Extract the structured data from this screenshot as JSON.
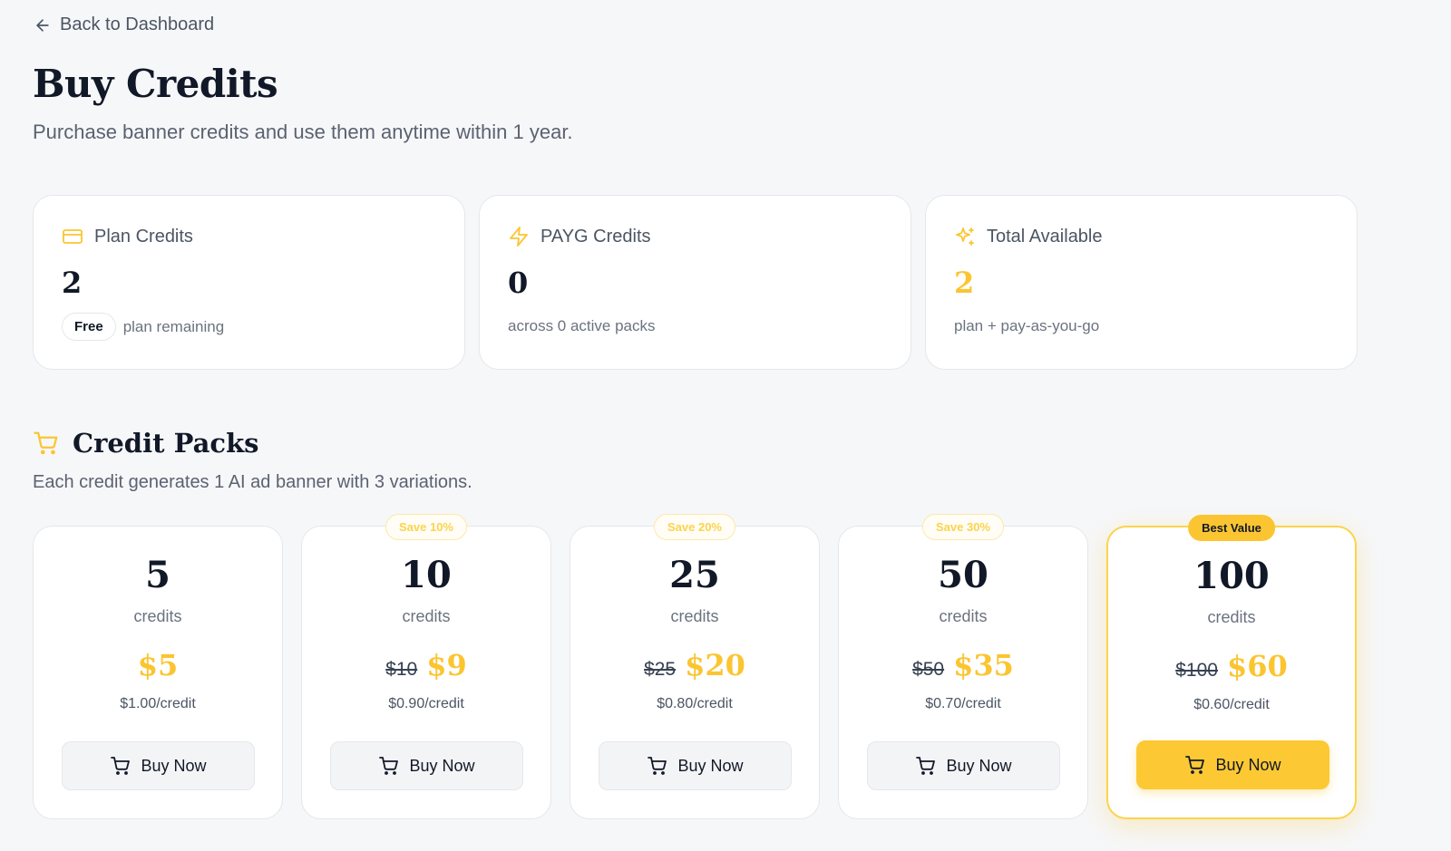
{
  "nav": {
    "back_label": "Back to Dashboard"
  },
  "header": {
    "title": "Buy Credits",
    "subtitle": "Purchase banner credits and use them anytime within 1 year."
  },
  "stats": {
    "plan": {
      "label": "Plan Credits",
      "value": "2",
      "badge": "Free",
      "note": "plan remaining",
      "icon": "credit-card-icon"
    },
    "payg": {
      "label": "PAYG Credits",
      "value": "0",
      "note": "across 0 active packs",
      "icon": "lightning-icon"
    },
    "total": {
      "label": "Total Available",
      "value": "2",
      "note": "plan + pay-as-you-go",
      "icon": "sparkles-icon"
    }
  },
  "packs_section": {
    "title": "Credit Packs",
    "subtitle": "Each credit generates 1 AI ad banner with 3 variations.",
    "icon": "cart-icon"
  },
  "packs": [
    {
      "amount": "5",
      "unit": "credits",
      "badge": "",
      "old_price": "",
      "price": "$5",
      "per_credit": "$1.00/credit",
      "button": "Buy Now"
    },
    {
      "amount": "10",
      "unit": "credits",
      "badge": "Save 10%",
      "old_price": "$10",
      "price": "$9",
      "per_credit": "$0.90/credit",
      "button": "Buy Now"
    },
    {
      "amount": "25",
      "unit": "credits",
      "badge": "Save 20%",
      "old_price": "$25",
      "price": "$20",
      "per_credit": "$0.80/credit",
      "button": "Buy Now"
    },
    {
      "amount": "50",
      "unit": "credits",
      "badge": "Save 30%",
      "old_price": "$50",
      "price": "$35",
      "per_credit": "$0.70/credit",
      "button": "Buy Now"
    },
    {
      "amount": "100",
      "unit": "credits",
      "badge": "Best Value",
      "old_price": "$100",
      "price": "$60",
      "per_credit": "$0.60/credit",
      "button": "Buy Now"
    }
  ],
  "colors": {
    "accent": "#fbc531",
    "text": "#111827",
    "muted": "#6b7280",
    "background": "#f6f7f9"
  }
}
